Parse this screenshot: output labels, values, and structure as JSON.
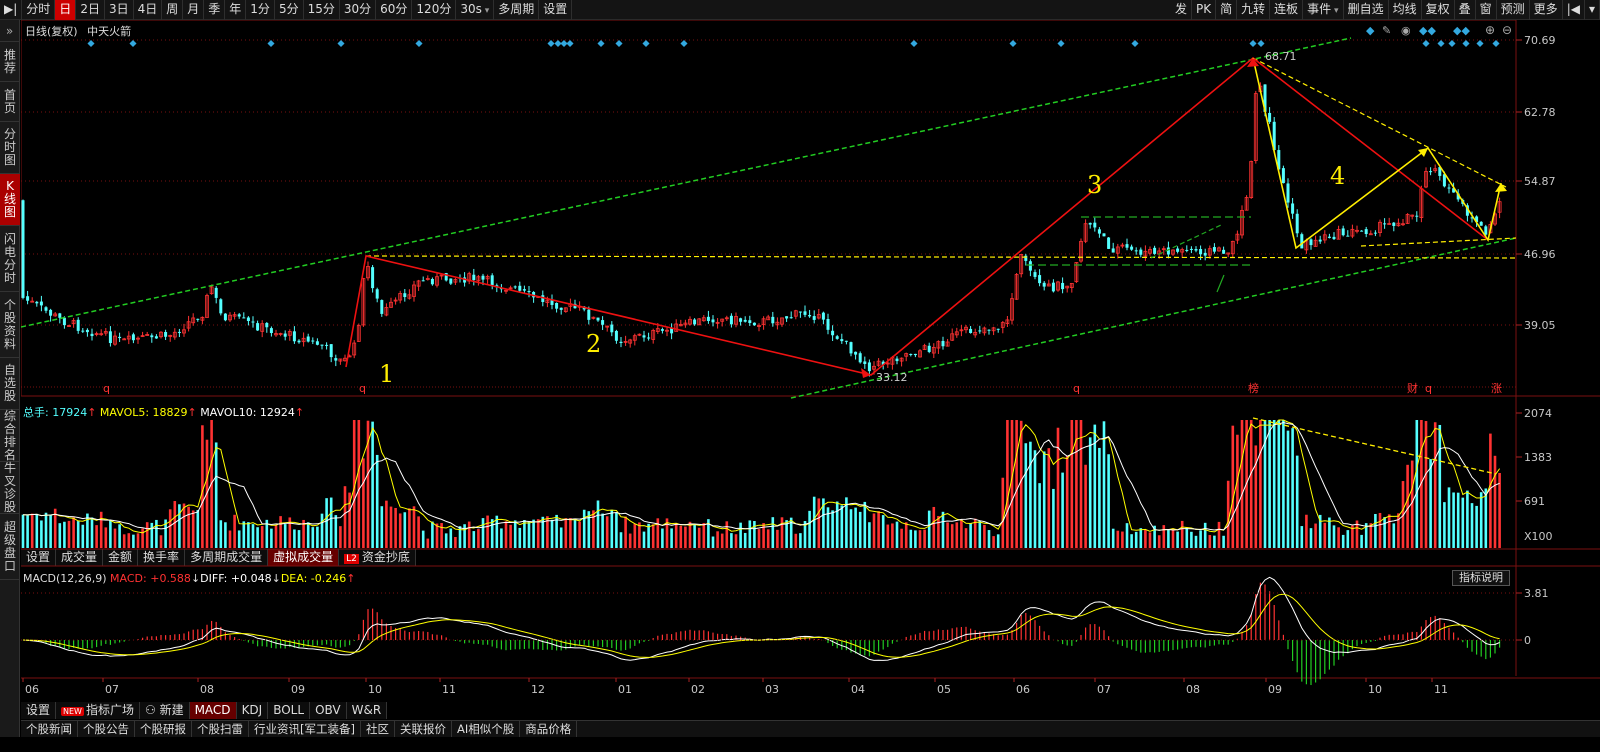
{
  "toolbar": {
    "left_items": [
      {
        "id": "play",
        "label": "▶|"
      },
      {
        "id": "fenshi",
        "label": "分时"
      },
      {
        "id": "day",
        "label": "日",
        "active": true
      },
      {
        "id": "2d",
        "label": "2日"
      },
      {
        "id": "3d",
        "label": "3日"
      },
      {
        "id": "4d",
        "label": "4日"
      },
      {
        "id": "week",
        "label": "周"
      },
      {
        "id": "month",
        "label": "月"
      },
      {
        "id": "season",
        "label": "季"
      },
      {
        "id": "year",
        "label": "年"
      },
      {
        "id": "1min",
        "label": "1分"
      },
      {
        "id": "5min",
        "label": "5分"
      },
      {
        "id": "15min",
        "label": "15分"
      },
      {
        "id": "30min",
        "label": "30分"
      },
      {
        "id": "60min",
        "label": "60分"
      },
      {
        "id": "120min",
        "label": "120分"
      },
      {
        "id": "30s",
        "label": "30s",
        "dropdown": true
      },
      {
        "id": "multi",
        "label": "多周期"
      },
      {
        "id": "settings",
        "label": "设置"
      }
    ],
    "right_items": [
      {
        "id": "fa",
        "label": "发"
      },
      {
        "id": "pk",
        "label": "PK"
      },
      {
        "id": "jian",
        "label": "简"
      },
      {
        "id": "jiuzhuan",
        "label": "九转"
      },
      {
        "id": "lianban",
        "label": "连板"
      },
      {
        "id": "event",
        "label": "事件",
        "dropdown": true
      },
      {
        "id": "delete-fav",
        "label": "删自选"
      },
      {
        "id": "junxian",
        "label": "均线"
      },
      {
        "id": "fuquan",
        "label": "复权"
      },
      {
        "id": "overlay",
        "label": "叠"
      },
      {
        "id": "window",
        "label": "窗"
      },
      {
        "id": "forecast",
        "label": "预测"
      },
      {
        "id": "more",
        "label": "更多"
      },
      {
        "id": "nav-prev",
        "label": "|◀"
      },
      {
        "id": "nav-down",
        "label": "▾"
      }
    ]
  },
  "leftnav": {
    "top_arrows": "»",
    "items": [
      {
        "id": "tuijian",
        "label": "推荐"
      },
      {
        "id": "shouye",
        "label": "首页"
      },
      {
        "id": "fenshitu",
        "label": "分时图"
      },
      {
        "id": "kxiantu",
        "label": "K线图",
        "active": true
      },
      {
        "id": "shandian",
        "label": "闪电分时"
      },
      {
        "id": "gegu",
        "label": "个股资料"
      },
      {
        "id": "zixuan",
        "label": "自选股"
      },
      {
        "id": "zonghe",
        "label": "综合排名"
      },
      {
        "id": "niucha",
        "label": "牛叉诊股"
      },
      {
        "id": "chaoji",
        "label": "超级盘口"
      }
    ]
  },
  "main_chart": {
    "title": "日线(复权)",
    "stock_name": "中天火箭",
    "price_axis": [
      "70.69",
      "62.78",
      "54.87",
      "46.96",
      "39.05"
    ],
    "high_label": "68.71",
    "low_label": "33.12",
    "wave_labels": [
      "1",
      "2",
      "3",
      "4"
    ],
    "markers": {
      "q": "q",
      "bang": "榜",
      "cai": "财",
      "zhang": "涨"
    },
    "colors": {
      "up": "#ff3232",
      "down": "#54ffff",
      "ma_white": "#ffffff",
      "ma_yellow": "#ffff00",
      "trend_green": "#22cc22",
      "trend_red": "#ee1111",
      "trend_yellow": "#ffee00",
      "grid": "#7a1010",
      "axis_text": "#c8c8c8",
      "marker": "#33a9e0"
    },
    "chart_tools": [
      "diamond-icon",
      "pen-icon",
      "eye-icon",
      "dots-icon",
      "plus-icon",
      "minus-icon"
    ]
  },
  "volume_panel": {
    "label_total": "总手: 17924",
    "label_ma5": "MAVOL5: 18829",
    "label_ma10": "MAVOL10: 12924",
    "axis": [
      "2074",
      "1383",
      "691",
      "X100"
    ]
  },
  "volume_tabs": [
    {
      "id": "settings",
      "label": "设置"
    },
    {
      "id": "vol",
      "label": "成交量"
    },
    {
      "id": "amount",
      "label": "金额"
    },
    {
      "id": "turnover",
      "label": "换手率"
    },
    {
      "id": "multi-vol",
      "label": "多周期成交量"
    },
    {
      "id": "virtual-vol",
      "label": "虚拟成交量",
      "active": true
    },
    {
      "id": "fund",
      "label": "资金抄底",
      "badge": "L2"
    }
  ],
  "macd_panel": {
    "label_name": "MACD(12,26,9)",
    "label_macd": "MACD: +0.588",
    "label_diff": "DIFF: +0.048",
    "label_dea": "DEA: -0.246",
    "axis": [
      "3.81",
      "0"
    ],
    "explain_button": "指标说明"
  },
  "x_axis": {
    "months": [
      "06",
      "07",
      "08",
      "09",
      "10",
      "11",
      "12",
      "01",
      "02",
      "03",
      "04",
      "05",
      "06",
      "07",
      "08",
      "09",
      "10",
      "11"
    ]
  },
  "indicator_tabs": [
    {
      "id": "settings",
      "label": "设置"
    },
    {
      "id": "plaza",
      "label": "指标广场",
      "badge": "NEW"
    },
    {
      "id": "new",
      "label": "新建"
    },
    {
      "id": "macd",
      "label": "MACD",
      "active": true
    },
    {
      "id": "kdj",
      "label": "KDJ"
    },
    {
      "id": "boll",
      "label": "BOLL"
    },
    {
      "id": "obv",
      "label": "OBV"
    },
    {
      "id": "wr",
      "label": "W&R"
    }
  ],
  "bottom_bar": [
    "个股新闻",
    "个股公告",
    "个股研报",
    "个股扫雷",
    "行业资讯[军工装备]",
    "社区",
    "关联报价",
    "AI相似个股",
    "商品价格"
  ]
}
